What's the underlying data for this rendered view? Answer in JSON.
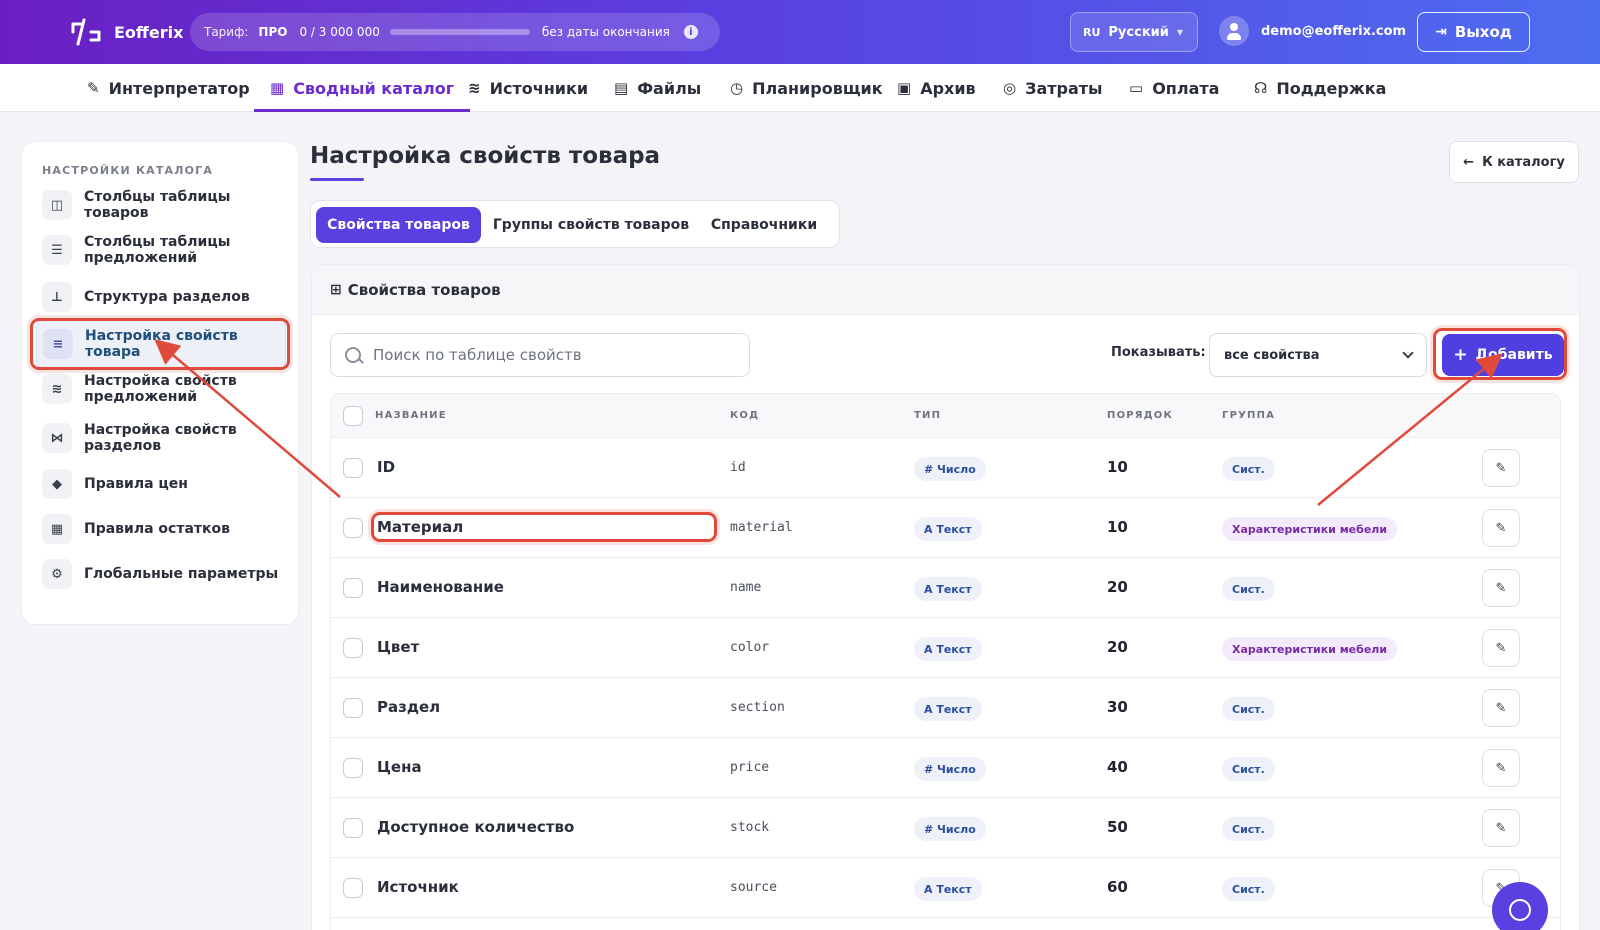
{
  "app": {
    "name": "Eofferix",
    "colors": {
      "brand": "#5b3fe0",
      "accent": "#6a2bd0",
      "highlight": "#e04a3a"
    }
  },
  "header": {
    "tariff_label": "Тариф:",
    "plan": "ПРО",
    "usage": "0 / 3 000 000",
    "usage_progress": 0,
    "no_end": "без даты окончания",
    "info_icon": "info-icon",
    "lang_code": "RU",
    "lang_name": "Русский",
    "user_email": "demo@eofferix.com",
    "logout_label": "Выход"
  },
  "nav": {
    "items": [
      {
        "label": "Интерпретатор",
        "icon": "magic-wand-icon"
      },
      {
        "label": "Сводный каталог",
        "icon": "boxes-icon",
        "active": true
      },
      {
        "label": "Источники",
        "icon": "layers-icon"
      },
      {
        "label": "Файлы",
        "icon": "files-icon"
      },
      {
        "label": "Планировщик",
        "icon": "clock-icon"
      },
      {
        "label": "Архив",
        "icon": "archive-icon"
      },
      {
        "label": "Затраты",
        "icon": "coins-icon"
      },
      {
        "label": "Оплата",
        "icon": "credit-card-icon"
      },
      {
        "label": "Поддержка",
        "icon": "headset-icon"
      }
    ]
  },
  "sidebar": {
    "title": "НАСТРОЙКИ КАТАЛОГА",
    "items": [
      {
        "label": "Столбцы таблицы товаров",
        "icon": "columns-icon"
      },
      {
        "label": "Столбцы таблицы предложений",
        "icon": "table-icon"
      },
      {
        "label": "Структура разделов",
        "icon": "sitemap-icon"
      },
      {
        "label": "Настройка свойств товара",
        "icon": "sliders-icon",
        "active": true
      },
      {
        "label": "Настройка свойств предложений",
        "icon": "layers-icon"
      },
      {
        "label": "Настройка свойств разделов",
        "icon": "diagram-icon"
      },
      {
        "label": "Правила цен",
        "icon": "tags-icon"
      },
      {
        "label": "Правила остатков",
        "icon": "boxes-icon"
      },
      {
        "label": "Глобальные параметры",
        "icon": "gear-icon"
      }
    ]
  },
  "page": {
    "title": "Настройка свойств товара",
    "back_label": "К каталогу",
    "tabs": [
      {
        "label": "Свойства товаров",
        "active": true
      },
      {
        "label": "Группы свойств товаров"
      },
      {
        "label": "Справочники"
      }
    ]
  },
  "card": {
    "title": "Свойства товаров",
    "search_placeholder": "Поиск по таблице свойств",
    "show_label": "Показывать:",
    "show_value": "все свойства",
    "add_label": "Добавить",
    "columns": [
      "НАЗВАНИЕ",
      "КОД",
      "ТИП",
      "ПОРЯДОК",
      "ГРУППА"
    ],
    "rows": [
      {
        "name": "ID",
        "code": "id",
        "type": "# Число",
        "order": "10",
        "group": "Сист.",
        "group_kind": "sys"
      },
      {
        "name": "Материал",
        "code": "material",
        "type": "A Текст",
        "order": "10",
        "group": "Характеристики мебели",
        "group_kind": "furn"
      },
      {
        "name": "Наименование",
        "code": "name",
        "type": "A Текст",
        "order": "20",
        "group": "Сист.",
        "group_kind": "sys"
      },
      {
        "name": "Цвет",
        "code": "color",
        "type": "A Текст",
        "order": "20",
        "group": "Характеристики мебели",
        "group_kind": "furn"
      },
      {
        "name": "Раздел",
        "code": "section",
        "type": "A Текст",
        "order": "30",
        "group": "Сист.",
        "group_kind": "sys"
      },
      {
        "name": "Цена",
        "code": "price",
        "type": "# Число",
        "order": "40",
        "group": "Сист.",
        "group_kind": "sys"
      },
      {
        "name": "Доступное количество",
        "code": "stock",
        "type": "# Число",
        "order": "50",
        "group": "Сист.",
        "group_kind": "sys"
      },
      {
        "name": "Источник",
        "code": "source",
        "type": "A Текст",
        "order": "60",
        "group": "Сист.",
        "group_kind": "sys"
      }
    ]
  }
}
